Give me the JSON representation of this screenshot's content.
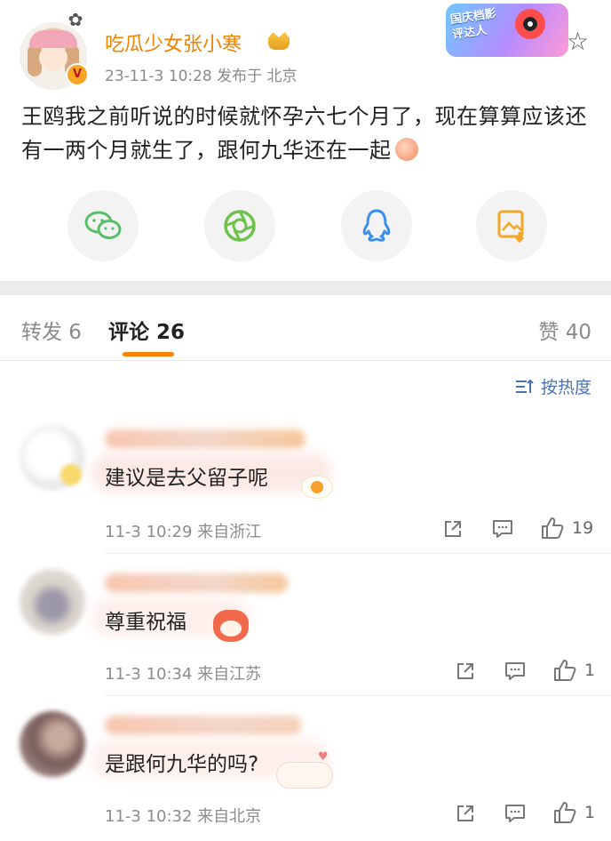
{
  "post": {
    "username": "吃瓜少女张小寒",
    "time_location": "23-11-3 10:28  发布于 北京",
    "badge": "V",
    "promo_text": "国庆档影评达人",
    "text": "王鸥我之前听说的时候就怀孕六七个月了，现在算算应该还有一两个月就生了，跟何九华还在一起",
    "share_icons": [
      "wechat-icon",
      "moments-icon",
      "qq-icon",
      "save-image-icon"
    ]
  },
  "tabs": {
    "repost": "转发 6",
    "comment": "评论 26",
    "like": "赞 40"
  },
  "sort_label": "按热度",
  "colors": {
    "accent": "#ff8200",
    "username": "#f08300",
    "link_blue": "#4a73b4",
    "wechat": "#57be6a",
    "moments": "#6cc24a",
    "qq": "#3d8ee8",
    "save": "#f5a623"
  },
  "comments": [
    {
      "text": "建议是去父留子呢",
      "meta": "11-3 10:29  来自浙江",
      "likes": "19",
      "sticker": "egg"
    },
    {
      "text": "尊重祝福",
      "meta": "11-3 10:34  来自江苏",
      "likes": "1",
      "sticker": "fox"
    },
    {
      "text": "是跟何九华的吗?",
      "meta": "11-3 10:32  来自北京",
      "likes": "1",
      "sticker": "bunny"
    }
  ]
}
